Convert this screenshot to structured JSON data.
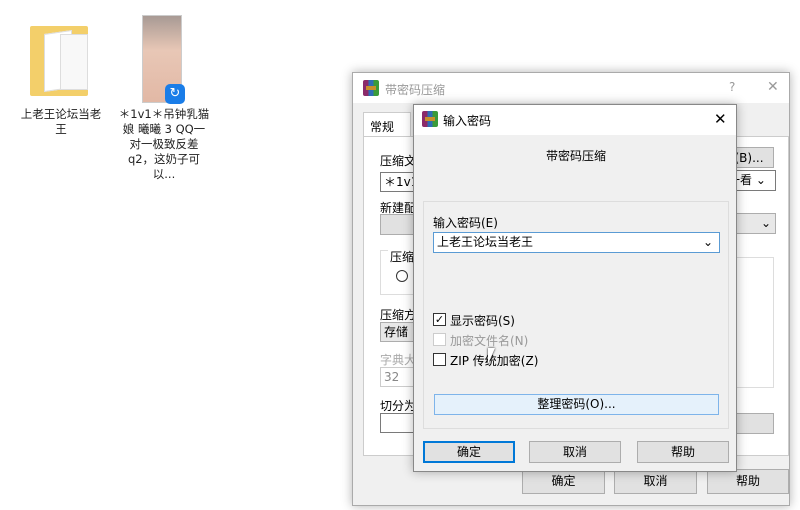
{
  "desktop": {
    "folder_label": "上老王论坛当老王",
    "file_label": "＊1v1＊吊钟乳猫娘 曦曦 3 QQ一对一极致反差q2，这奶子可以..."
  },
  "back_dialog": {
    "title": "带密码压缩",
    "help": "?",
    "close": "✕",
    "tab": "常规",
    "archive_label": "压缩文",
    "archive_value": "＊1v1＊",
    "profile_label": "新建配",
    "group_label": "压缩",
    "method_label": "压缩方",
    "method_value": "存储",
    "dict_label": "字典大",
    "dict_value": "32",
    "split_label": "切分为",
    "browse": "(B)...",
    "update_mode": "一看",
    "ok": "确定",
    "cancel": "取消",
    "help_btn": "帮助"
  },
  "front_dialog": {
    "title": "输入密码",
    "close": "✕",
    "subtitle": "带密码压缩",
    "password_label": "输入密码(E)",
    "password_value": "上老王论坛当老王",
    "show_password": "显示密码(S)",
    "show_password_checked": true,
    "encrypt_names": "加密文件名(N)",
    "encrypt_names_checked": false,
    "encrypt_names_enabled": false,
    "zip_legacy": "ZIP 传统加密(Z)",
    "zip_legacy_checked": false,
    "organize": "整理密码(O)...",
    "ok": "确定",
    "cancel": "取消",
    "help": "帮助"
  }
}
